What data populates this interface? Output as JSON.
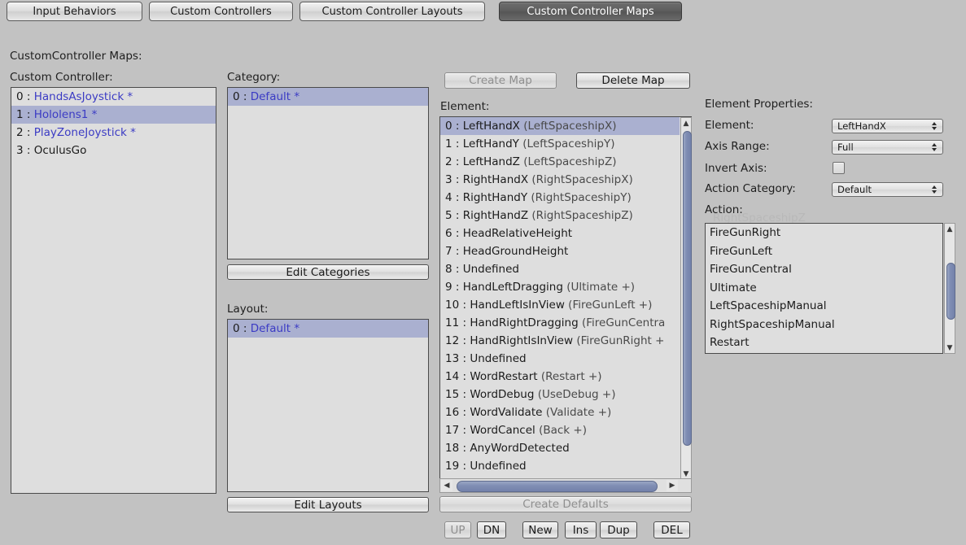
{
  "tabs": [
    {
      "label": "Input Behaviors",
      "active": false
    },
    {
      "label": "Custom Controllers",
      "active": false
    },
    {
      "label": "Custom Controller Layouts",
      "active": false
    },
    {
      "label": "Custom Controller Maps",
      "active": true
    }
  ],
  "page_title": "CustomController Maps:",
  "custom_controller": {
    "label": "Custom Controller:",
    "items": [
      {
        "index": "0 :",
        "name": "HandsAsJoystick",
        "star": " *",
        "link": true,
        "selected": false
      },
      {
        "index": "1 :",
        "name": "Hololens1",
        "star": " *",
        "link": true,
        "selected": true
      },
      {
        "index": "2 :",
        "name": "PlayZoneJoystick",
        "star": " *",
        "link": true,
        "selected": false
      },
      {
        "index": "3 :",
        "name": "OculusGo",
        "star": "",
        "link": false,
        "selected": false
      }
    ]
  },
  "category": {
    "label": "Category:",
    "items": [
      {
        "index": "0 :",
        "name": "Default",
        "star": " *",
        "link": true,
        "selected": true
      }
    ],
    "edit_button": "Edit Categories"
  },
  "layout": {
    "label": "Layout:",
    "items": [
      {
        "index": "0 :",
        "name": "Default",
        "star": " *",
        "link": true,
        "selected": true
      }
    ],
    "edit_button": "Edit Layouts"
  },
  "map_buttons": {
    "create": "Create Map",
    "create_disabled": true,
    "delete": "Delete Map",
    "delete_disabled": false
  },
  "element_list": {
    "label": "Element:",
    "items": [
      {
        "index": "0 :",
        "name": "LeftHandX",
        "action": "(LeftSpaceshipX)",
        "selected": true
      },
      {
        "index": "1 :",
        "name": "LeftHandY",
        "action": "(LeftSpaceshipY)",
        "selected": false
      },
      {
        "index": "2 :",
        "name": "LeftHandZ",
        "action": "(LeftSpaceshipZ)",
        "selected": false
      },
      {
        "index": "3 :",
        "name": "RightHandX",
        "action": "(RightSpaceshipX)",
        "selected": false
      },
      {
        "index": "4 :",
        "name": "RightHandY",
        "action": "(RightSpaceshipY)",
        "selected": false
      },
      {
        "index": "5 :",
        "name": "RightHandZ",
        "action": "(RightSpaceshipZ)",
        "selected": false
      },
      {
        "index": "6 :",
        "name": "HeadRelativeHeight",
        "action": "",
        "selected": false
      },
      {
        "index": "7 :",
        "name": "HeadGroundHeight",
        "action": "",
        "selected": false
      },
      {
        "index": "8 :",
        "name": "Undefined",
        "action": "",
        "selected": false
      },
      {
        "index": "9 :",
        "name": "HandLeftDragging",
        "action": "(Ultimate +)",
        "selected": false
      },
      {
        "index": "10 :",
        "name": "HandLeftIsInView",
        "action": "(FireGunLeft +)",
        "selected": false
      },
      {
        "index": "11 :",
        "name": "HandRightDragging",
        "action": "(FireGunCentra",
        "selected": false
      },
      {
        "index": "12 :",
        "name": "HandRightIsInView",
        "action": "(FireGunRight +",
        "selected": false
      },
      {
        "index": "13 :",
        "name": "Undefined",
        "action": "",
        "selected": false
      },
      {
        "index": "14 :",
        "name": "WordRestart",
        "action": "(Restart +)",
        "selected": false
      },
      {
        "index": "15 :",
        "name": "WordDebug",
        "action": "(UseDebug +)",
        "selected": false
      },
      {
        "index": "16 :",
        "name": "WordValidate",
        "action": "(Validate +)",
        "selected": false
      },
      {
        "index": "17 :",
        "name": "WordCancel",
        "action": "(Back +)",
        "selected": false
      },
      {
        "index": "18 :",
        "name": "AnyWordDetected",
        "action": "",
        "selected": false
      },
      {
        "index": "19 :",
        "name": "Undefined",
        "action": "",
        "selected": false
      }
    ]
  },
  "create_defaults_button": {
    "label": "Create Defaults",
    "disabled": true
  },
  "action_buttons": [
    {
      "label": "UP",
      "disabled": true
    },
    {
      "label": "DN",
      "disabled": false
    },
    {
      "label": "New",
      "disabled": false
    },
    {
      "label": "Ins",
      "disabled": false
    },
    {
      "label": "Dup",
      "disabled": false
    },
    {
      "label": "DEL",
      "disabled": false
    }
  ],
  "element_properties": {
    "title": "Element Properties:",
    "element_label": "Element:",
    "element_value": "LeftHandX",
    "axis_range_label": "Axis Range:",
    "axis_range_value": "Full",
    "invert_axis_label": "Invert Axis:",
    "invert_axis_checked": false,
    "action_category_label": "Action Category:",
    "action_category_value": "Default",
    "action_label": "Action:",
    "action_items": [
      {
        "name": "RightSpaceshipZ",
        "clipped": true
      },
      {
        "name": "FireGunRight",
        "clipped": false
      },
      {
        "name": "FireGunLeft",
        "clipped": false
      },
      {
        "name": "FireGunCentral",
        "clipped": false
      },
      {
        "name": "Ultimate",
        "clipped": false
      },
      {
        "name": "LeftSpaceshipManual",
        "clipped": false
      },
      {
        "name": "RightSpaceshipManual",
        "clipped": false
      },
      {
        "name": "Restart",
        "clipped": false
      }
    ]
  },
  "colors": {
    "background": "#c2c2c2",
    "list_background": "#dedede",
    "selection": "#aab0d0",
    "link_text": "#3b3bc4",
    "scroll_thumb": "#7f8db3"
  }
}
